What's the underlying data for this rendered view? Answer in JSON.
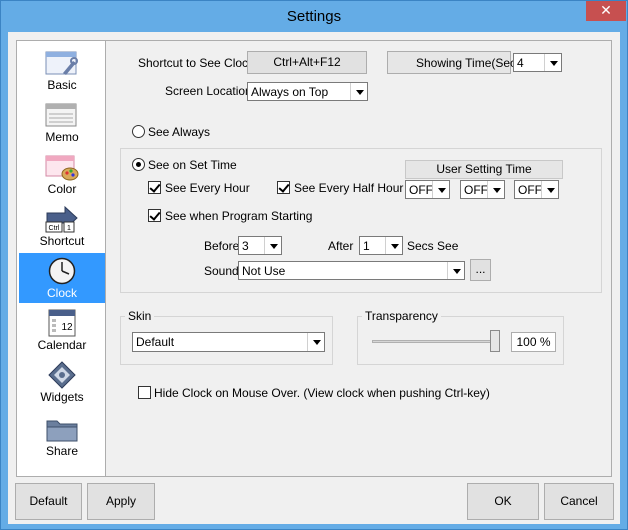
{
  "window": {
    "title": "Settings",
    "close_glyph": "✕"
  },
  "sidebar": {
    "items": [
      {
        "label": "Basic",
        "icon": "basic-icon"
      },
      {
        "label": "Memo",
        "icon": "memo-icon"
      },
      {
        "label": "Color",
        "icon": "color-icon"
      },
      {
        "label": "Shortcut",
        "icon": "shortcut-icon"
      },
      {
        "label": "Clock",
        "icon": "clock-icon",
        "selected": true
      },
      {
        "label": "Calendar",
        "icon": "calendar-icon"
      },
      {
        "label": "Widgets",
        "icon": "widgets-icon"
      },
      {
        "label": "Share",
        "icon": "share-icon"
      }
    ],
    "shortcut_badge_ctrl": "Ctrl",
    "shortcut_badge_key": "1",
    "calendar_day": "12"
  },
  "clock": {
    "shortcut_label": "Shortcut to See Clock",
    "shortcut_value": "Ctrl+Alt+F12",
    "showing_time_label": "Showing Time(Sec)",
    "showing_time_value": "4",
    "screen_location_label": "Screen Location",
    "screen_location_value": "Always on Top",
    "see_always_label": "See Always",
    "see_on_set_time_label": "See on Set Time",
    "see_every_hour_label": "See Every Hour",
    "see_every_half_hour_label": "See Every Half Hour",
    "user_setting_time_label": "User Setting Time",
    "user_time_1": "OFF",
    "user_time_2": "OFF",
    "user_time_3": "OFF",
    "see_program_start_label": "See when Program Starting",
    "before_label": "Before",
    "before_value": "3",
    "after_label": "After",
    "after_value": "1",
    "secs_see_label": "Secs See",
    "sound_label": "Sound",
    "sound_value": "Not Use",
    "browse_label": "...",
    "skin_label": "Skin",
    "skin_value": "Default",
    "transparency_label": "Transparency",
    "transparency_value": "100 %",
    "transparency_fraction": 1.0,
    "hide_clock_label": "Hide Clock on Mouse Over. (View clock when pushing Ctrl-key)"
  },
  "footer": {
    "default_label": "Default",
    "apply_label": "Apply",
    "ok_label": "OK",
    "cancel_label": "Cancel"
  },
  "colors": {
    "frame": "#64ace6",
    "selection": "#3399ff",
    "close": "#c75050"
  }
}
